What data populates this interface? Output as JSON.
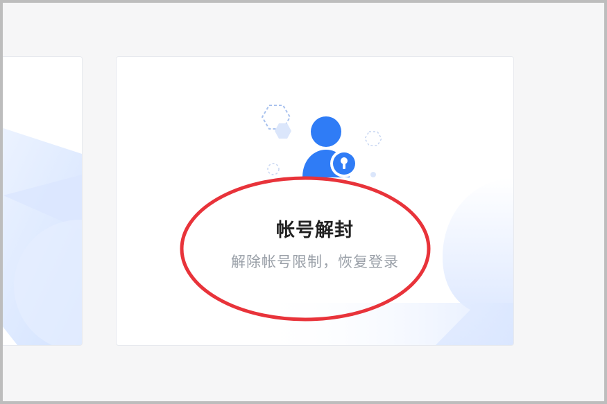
{
  "cards": {
    "unban": {
      "title": "帐号解封",
      "subtitle": "解除帐号限制，恢复登录",
      "icon": "user-lock-icon"
    }
  },
  "colors": {
    "background": "#f6f6f7",
    "card": "#ffffff",
    "accent_blue": "#2f7cf6",
    "highlight_ring": "#e8333a",
    "title_text": "#222222",
    "subtitle_text": "#9aa0a8"
  }
}
